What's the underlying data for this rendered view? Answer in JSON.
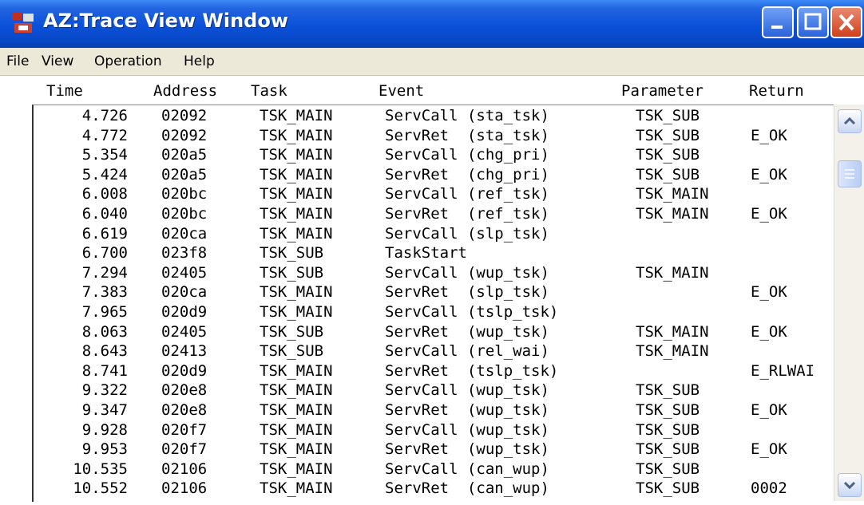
{
  "window": {
    "title": "AZ:Trace View Window"
  },
  "menu": {
    "file": "File",
    "view": "View",
    "operation": "Operation",
    "help": "Help"
  },
  "columns": {
    "time": "Time",
    "address": "Address",
    "task": "Task",
    "event": "Event",
    "parameter": "Parameter",
    "return": "Return"
  },
  "rows": [
    {
      "time": "4.726",
      "address": "02092",
      "task": "TSK_MAIN",
      "event": "ServCall (sta_tsk)",
      "parameter": "TSK_SUB",
      "return": ""
    },
    {
      "time": "4.772",
      "address": "02092",
      "task": "TSK_MAIN",
      "event": "ServRet  (sta_tsk)",
      "parameter": "TSK_SUB",
      "return": "E_OK"
    },
    {
      "time": "5.354",
      "address": "020a5",
      "task": "TSK_MAIN",
      "event": "ServCall (chg_pri)",
      "parameter": "TSK_SUB",
      "return": ""
    },
    {
      "time": "5.424",
      "address": "020a5",
      "task": "TSK_MAIN",
      "event": "ServRet  (chg_pri)",
      "parameter": "TSK_SUB",
      "return": "E_OK"
    },
    {
      "time": "6.008",
      "address": "020bc",
      "task": "TSK_MAIN",
      "event": "ServCall (ref_tsk)",
      "parameter": "TSK_MAIN",
      "return": ""
    },
    {
      "time": "6.040",
      "address": "020bc",
      "task": "TSK_MAIN",
      "event": "ServRet  (ref_tsk)",
      "parameter": "TSK_MAIN",
      "return": "E_OK"
    },
    {
      "time": "6.619",
      "address": "020ca",
      "task": "TSK_MAIN",
      "event": "ServCall (slp_tsk)",
      "parameter": "",
      "return": ""
    },
    {
      "time": "6.700",
      "address": "023f8",
      "task": "TSK_SUB",
      "event": "TaskStart",
      "parameter": "",
      "return": ""
    },
    {
      "time": "7.294",
      "address": "02405",
      "task": "TSK_SUB",
      "event": "ServCall (wup_tsk)",
      "parameter": "TSK_MAIN",
      "return": ""
    },
    {
      "time": "7.383",
      "address": "020ca",
      "task": "TSK_MAIN",
      "event": "ServRet  (slp_tsk)",
      "parameter": "",
      "return": "E_OK"
    },
    {
      "time": "7.965",
      "address": "020d9",
      "task": "TSK_MAIN",
      "event": "ServCall (tslp_tsk)",
      "parameter": "",
      "return": ""
    },
    {
      "time": "8.063",
      "address": "02405",
      "task": "TSK_SUB",
      "event": "ServRet  (wup_tsk)",
      "parameter": "TSK_MAIN",
      "return": "E_OK"
    },
    {
      "time": "8.643",
      "address": "02413",
      "task": "TSK_SUB",
      "event": "ServCall (rel_wai)",
      "parameter": "TSK_MAIN",
      "return": ""
    },
    {
      "time": "8.741",
      "address": "020d9",
      "task": "TSK_MAIN",
      "event": "ServRet  (tslp_tsk)",
      "parameter": "",
      "return": "E_RLWAI"
    },
    {
      "time": "9.322",
      "address": "020e8",
      "task": "TSK_MAIN",
      "event": "ServCall (wup_tsk)",
      "parameter": "TSK_SUB",
      "return": ""
    },
    {
      "time": "9.347",
      "address": "020e8",
      "task": "TSK_MAIN",
      "event": "ServRet  (wup_tsk)",
      "parameter": "TSK_SUB",
      "return": "E_OK"
    },
    {
      "time": "9.928",
      "address": "020f7",
      "task": "TSK_MAIN",
      "event": "ServCall (wup_tsk)",
      "parameter": "TSK_SUB",
      "return": ""
    },
    {
      "time": "9.953",
      "address": "020f7",
      "task": "TSK_MAIN",
      "event": "ServRet  (wup_tsk)",
      "parameter": "TSK_SUB",
      "return": "E_OK"
    },
    {
      "time": "10.535",
      "address": "02106",
      "task": "TSK_MAIN",
      "event": "ServCall (can_wup)",
      "parameter": "TSK_SUB",
      "return": ""
    },
    {
      "time": "10.552",
      "address": "02106",
      "task": "TSK_MAIN",
      "event": "ServRet  (can_wup)",
      "parameter": "TSK_SUB",
      "return": "0002"
    }
  ]
}
